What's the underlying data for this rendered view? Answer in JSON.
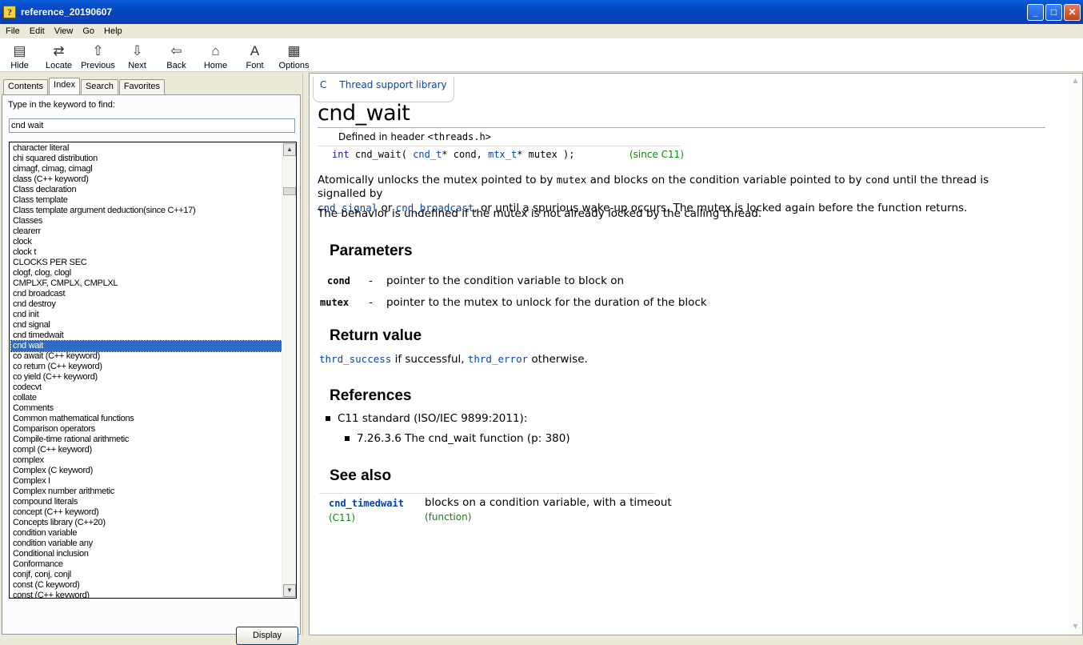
{
  "window": {
    "title": "reference_20190607"
  },
  "menu": [
    "File",
    "Edit",
    "View",
    "Go",
    "Help"
  ],
  "toolbar": [
    {
      "label": "Hide",
      "icon": "hide-icon"
    },
    {
      "label": "Locate",
      "icon": "locate-icon"
    },
    {
      "label": "Previous",
      "icon": "up-arrow-icon"
    },
    {
      "label": "Next",
      "icon": "down-arrow-icon"
    },
    {
      "label": "Back",
      "icon": "back-arrow-icon"
    },
    {
      "label": "Home",
      "icon": "home-icon"
    },
    {
      "label": "Font",
      "icon": "font-icon"
    },
    {
      "label": "Options",
      "icon": "options-icon"
    }
  ],
  "left": {
    "tabs": [
      "Contents",
      "Index",
      "Search",
      "Favorites"
    ],
    "active_tab": "Index",
    "prompt": "Type in the keyword to find:",
    "keyword": "cnd wait",
    "items": [
      "character literal",
      "chi squared distribution",
      "cimagf, cimag, cimagl",
      "class (C++ keyword)",
      "Class declaration",
      "Class template",
      "Class template argument deduction(since C++17)",
      "Classes",
      "clearerr",
      "clock",
      "clock t",
      "CLOCKS PER SEC",
      "clogf, clog, clogl",
      "CMPLXF, CMPLX, CMPLXL",
      "cnd broadcast",
      "cnd destroy",
      "cnd init",
      "cnd signal",
      "cnd timedwait",
      "cnd wait",
      "co await (C++ keyword)",
      "co return (C++ keyword)",
      "co yield (C++ keyword)",
      "codecvt",
      "collate",
      "Comments",
      "Common mathematical functions",
      "Comparison operators",
      "Compile-time rational arithmetic",
      "compl (C++ keyword)",
      "complex",
      "Complex (C keyword)",
      "Complex I",
      "Complex number arithmetic",
      "compound literals",
      "concept (C++ keyword)",
      "Concepts library (C++20)",
      "condition variable",
      "condition variable any",
      "Conditional inclusion",
      "Conformance",
      "conjf, conj, conjl",
      "const (C keyword)",
      "const (C++ keyword)"
    ],
    "selected_index": 19,
    "display_label": "Display"
  },
  "doc": {
    "crumb_c": "C",
    "crumb_lib": "Thread support library",
    "title": "cnd_wait",
    "defined_in": "Defined in header",
    "header": "<threads.h>",
    "sig": {
      "kw": "int",
      "name": " cnd_wait( ",
      "t1": "cnd_t",
      "p1": "* cond, ",
      "t2": "mtx_t",
      "p2": "* mutex );"
    },
    "since": "(since C11)",
    "desc": {
      "a": "Atomically unlocks the mutex pointed to by ",
      "b": "mutex",
      "c": " and blocks on the condition variable pointed to by ",
      "d": "cond",
      "e": " until the thread is signalled by",
      "f": "cnd_signal",
      "g": " or ",
      "h": "cnd_broadcast",
      "i": ", or until a spurious wake-up occurs. The mutex is locked again before the function returns."
    },
    "desc2": "The behavior is undefined if the mutex is not already locked by the calling thread.",
    "params_heading": "Parameters",
    "params": [
      {
        "name": "cond",
        "dash": "-",
        "text": "pointer to the condition variable to block on"
      },
      {
        "name": "mutex",
        "dash": "-",
        "text": "pointer to the mutex to unlock for the duration of the block"
      }
    ],
    "return_heading": "Return value",
    "ret": {
      "a": "thrd_success",
      "b": " if successful, ",
      "c": "thrd_error",
      "d": " otherwise."
    },
    "refs_heading": "References",
    "ref1": "C11 standard (ISO/IEC 9899:2011):",
    "ref2": "7.26.3.6 The cnd_wait function (p: 380)",
    "seealso_heading": "See also",
    "seealso": {
      "name": "cnd_timedwait",
      "ver": "(C11)",
      "desc": "blocks on a condition variable, with a timeout",
      "kind": "(function)"
    }
  }
}
